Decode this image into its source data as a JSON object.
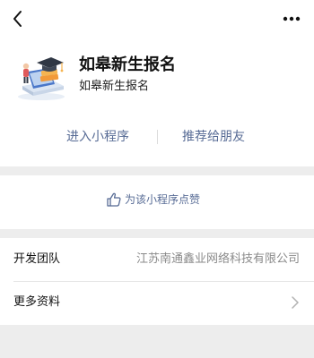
{
  "nav": {
    "back_icon": "chevron-left-icon",
    "more_icon": "more-horizontal-icon"
  },
  "app": {
    "name": "如皋新生报名",
    "description": "如皋新生报名",
    "logo_icon": "graduation-cap-logo"
  },
  "actions": {
    "enter_label": "进入小程序",
    "share_label": "推荐给朋友"
  },
  "like": {
    "icon": "thumbs-up-icon",
    "label": "为该小程序点赞"
  },
  "info": {
    "rows": [
      {
        "label": "开发团队",
        "value": "江苏南通鑫业网络科技有限公司"
      },
      {
        "label": "更多资料",
        "value": ""
      }
    ]
  },
  "colors": {
    "link": "#576b95",
    "background": "#ededed",
    "panel": "#ffffff",
    "secondary_text": "#8a8a8a"
  }
}
